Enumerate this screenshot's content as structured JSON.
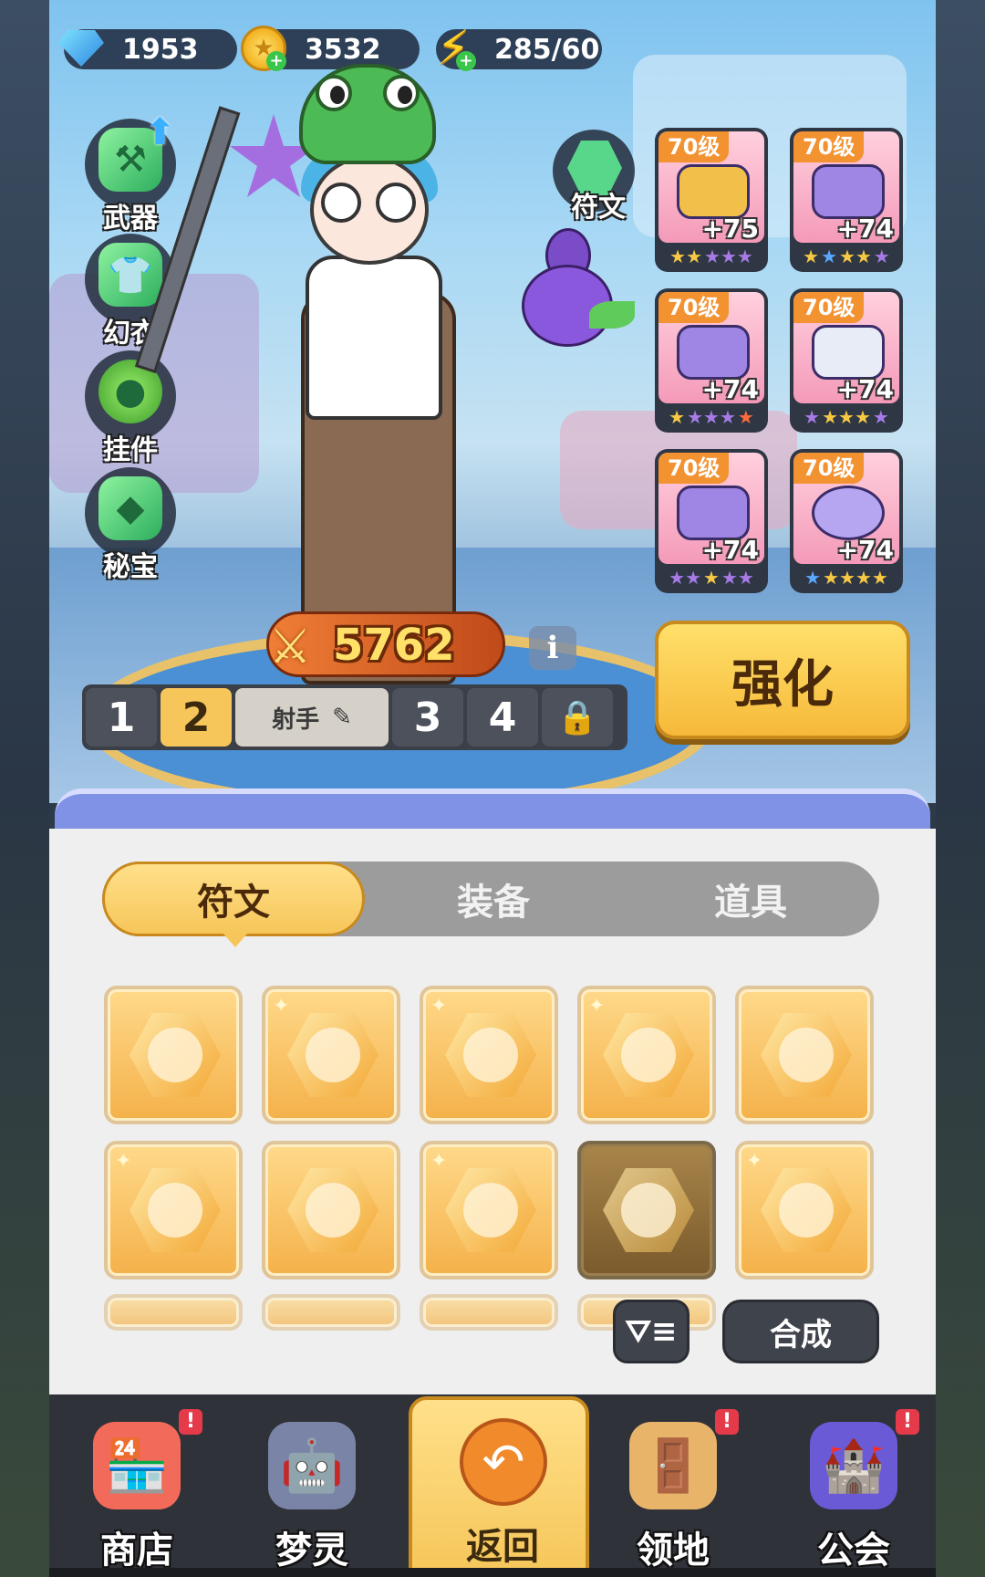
{
  "currency": {
    "gems": "1953",
    "gold": "3532",
    "energy": "285/60"
  },
  "left_menu": [
    {
      "label": "武器",
      "icon": "weapon-icon"
    },
    {
      "label": "幻衣",
      "icon": "costume-icon"
    },
    {
      "label": "挂件",
      "icon": "pendant-icon"
    },
    {
      "label": "秘宝",
      "icon": "treasure-icon"
    }
  ],
  "rune_slot": {
    "label": "符文",
    "icon": "rune-icon"
  },
  "equipment": [
    {
      "level": "70级",
      "bonus": "+75",
      "icon": "helmet-icon",
      "stars": "★★★★★"
    },
    {
      "level": "70级",
      "bonus": "+74",
      "icon": "armor-icon",
      "stars": "★★★★★"
    },
    {
      "level": "70级",
      "bonus": "+74",
      "icon": "bracer-icon",
      "stars": "★★★★★"
    },
    {
      "level": "70级",
      "bonus": "+74",
      "icon": "pants-icon",
      "stars": "★★★★★"
    },
    {
      "level": "70级",
      "bonus": "+74",
      "icon": "boots-icon",
      "stars": "★★★★★"
    },
    {
      "level": "70级",
      "bonus": "+74",
      "icon": "orb-icon",
      "stars": "★★★★★"
    }
  ],
  "power": "5762",
  "info": "i",
  "presets": {
    "p1": "1",
    "p2": "2",
    "role": "射手",
    "p3": "3",
    "p4": "4"
  },
  "enhance_label": "强化",
  "tabs": [
    "符文",
    "装备",
    "道具"
  ],
  "merge_label": "合成",
  "nav": [
    {
      "label": "商店",
      "icon": "shop-icon",
      "badge": "!"
    },
    {
      "label": "梦灵",
      "icon": "spirit-icon",
      "badge": ""
    },
    {
      "label": "返回",
      "icon": "back-icon",
      "badge": ""
    },
    {
      "label": "领地",
      "icon": "territory-icon",
      "badge": "!"
    },
    {
      "label": "公会",
      "icon": "guild-icon",
      "badge": "!"
    }
  ],
  "colors": {
    "accent_yellow": "#f6c65a",
    "panel_bg": "#efefef",
    "nav_bg": "#2f3238",
    "badge_red": "#e43a4a"
  }
}
